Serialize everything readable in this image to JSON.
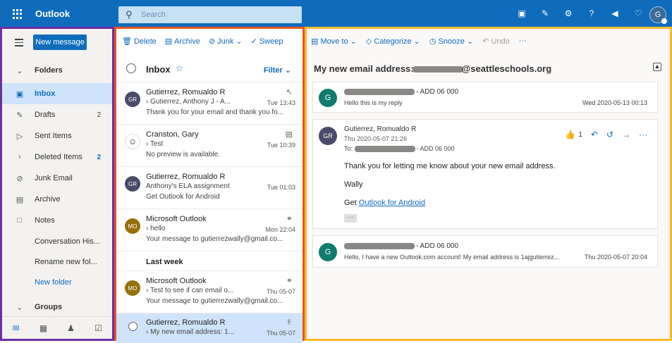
{
  "topbar": {
    "app_name": "Outlook",
    "search_placeholder": "Search",
    "avatar_initial": "G",
    "colors": {
      "bar": "#0f6cbd",
      "search_bg": "#c7e0f4"
    }
  },
  "leftnav": {
    "new_message": "New message",
    "items": [
      {
        "label": "Folders",
        "count": ""
      },
      {
        "label": "Inbox",
        "count": ""
      },
      {
        "label": "Drafts",
        "count": "2"
      },
      {
        "label": "Sent Items",
        "count": ""
      },
      {
        "label": "Deleted Items",
        "count": "2"
      },
      {
        "label": "Junk Email",
        "count": ""
      },
      {
        "label": "Archive",
        "count": ""
      },
      {
        "label": "Notes",
        "count": ""
      },
      {
        "label": "Conversation His...",
        "count": ""
      },
      {
        "label": "Rename new fol...",
        "count": ""
      },
      {
        "label": "New folder",
        "count": ""
      },
      {
        "label": "Groups",
        "count": ""
      }
    ]
  },
  "listtoolbar": {
    "delete": "Delete",
    "archive": "Archive",
    "junk": "Junk",
    "sweep": "Sweep"
  },
  "list": {
    "title": "Inbox",
    "filter": "Filter",
    "section_last_week": "Last week",
    "messages": [
      {
        "avatar": "GR",
        "from": "Gutierrez, Romualdo R",
        "subject": "Gutierrez, Anthony J - A...",
        "time": "Tue 13:43",
        "preview": "Thank you for your email and thank you fo..."
      },
      {
        "avatar": "☺",
        "from": "Cranston, Gary",
        "subject": "Test",
        "time": "Tue 10:39",
        "preview": "No preview is available."
      },
      {
        "avatar": "GR",
        "from": "Gutierrez, Romualdo R",
        "subject": "Anthony's ELA assignment",
        "time": "Tue 01:03",
        "preview": "Get Outlook for Android"
      },
      {
        "avatar": "MO",
        "from": "Microsoft Outlook",
        "subject": "hello",
        "time": "Mon 22:04",
        "preview": "Your message to gutierrezwally@gmail.co..."
      },
      {
        "avatar": "MO",
        "from": "Microsoft Outlook",
        "subject": "Test to see if can email o...",
        "time": "Thu 05-07",
        "preview": "Your message to gutierrezwally@gmail.co..."
      },
      {
        "avatar": "",
        "from": "Gutierrez, Romualdo R",
        "subject": "My new email address: 1...",
        "time": "Thu 05-07",
        "preview": ""
      }
    ]
  },
  "readtoolbar": {
    "move_to": "Move to",
    "categorize": "Categorize",
    "snooze": "Snooze",
    "undo": "Undo",
    "more": "···"
  },
  "reading": {
    "subject_prefix": "My new email address:",
    "subject_suffix": "@seattleschools.org",
    "cards": [
      {
        "avatar": "G",
        "sender_suffix": "- ADD 06 000",
        "snippet": "Hello this is my reply",
        "date": "Wed 2020-05-13 00:13"
      },
      {
        "avatar": "GR",
        "sender": "Gutierrez, Romualdo R",
        "date": "Thu 2020-05-07 21:26",
        "to_label": "To:",
        "to_suffix": "- ADD 06 000",
        "like_count": "1",
        "body_line1": "Thank you for letting me know about your new email address.",
        "body_line2": "Wally",
        "body_line3_prefix": "Get",
        "body_link": "Outlook for Android",
        "more": "···"
      },
      {
        "avatar": "G",
        "sender_suffix": "- ADD 06 000",
        "snippet": "Hello, I have a new Outlook.com account! My email address is 1ajgutierrez...",
        "date": "Thu 2020-05-07 20:04"
      }
    ]
  }
}
